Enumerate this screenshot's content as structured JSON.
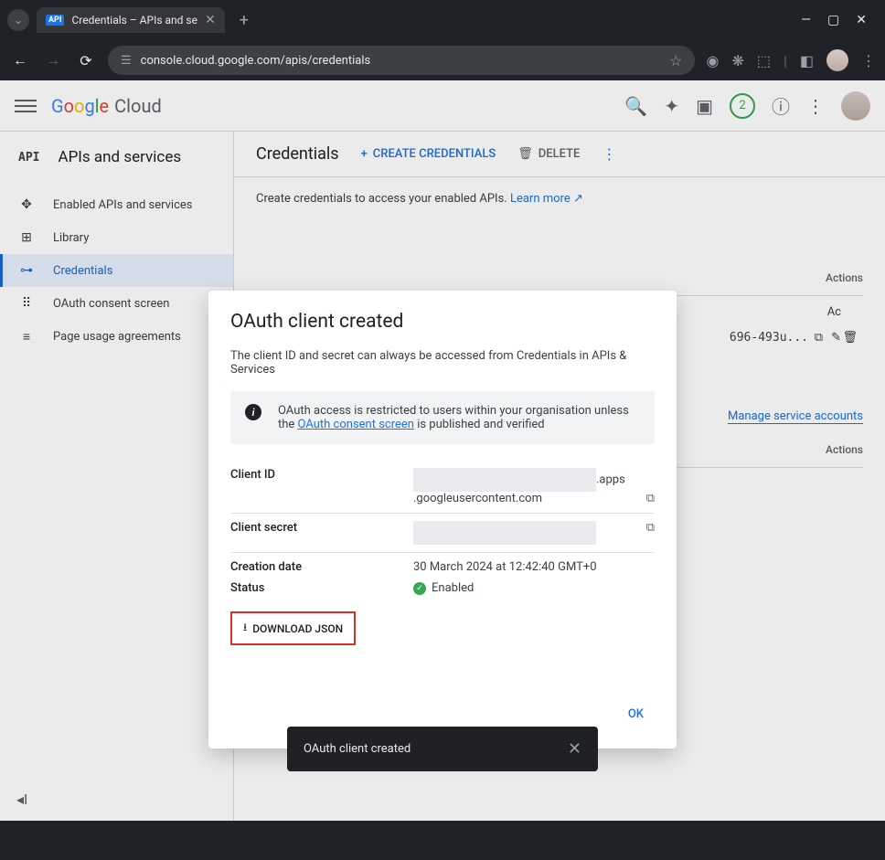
{
  "browser": {
    "tab_title": "Credentials – APIs and se",
    "url": "console.cloud.google.com/apis/credentials"
  },
  "header": {
    "logo_cloud": "Cloud",
    "notification_count": "2"
  },
  "sidebar": {
    "api_label": "API",
    "title": "APIs and services",
    "items": [
      {
        "label": "Enabled APIs and services"
      },
      {
        "label": "Library"
      },
      {
        "label": "Credentials"
      },
      {
        "label": "OAuth consent screen"
      },
      {
        "label": "Page usage agreements"
      }
    ]
  },
  "main": {
    "title": "Credentials",
    "create_label": "CREATE CREDENTIALS",
    "delete_label": "DELETE",
    "intro": "Create credentials to access your enabled APIs.",
    "learn_more": "Learn more",
    "actions_col": "Actions",
    "actions_col2": "Ac",
    "client_id_frag": "696-493u...",
    "manage_link": "Manage service accounts"
  },
  "dialog": {
    "title": "OAuth client created",
    "desc": "The client ID and secret can always be accessed from Credentials in APIs & Services",
    "info_prefix": "OAuth access is restricted to users within your organisation unless the ",
    "info_link": "OAuth consent screen",
    "info_suffix": " is published and verified",
    "client_id_label": "Client ID",
    "client_id_suffix": ".apps",
    "client_id_suffix2": ".googleusercontent.com",
    "client_secret_label": "Client secret",
    "creation_label": "Creation date",
    "creation_value": "30 March 2024 at 12:42:40 GMT+0",
    "status_label": "Status",
    "status_value": "Enabled",
    "download_label": "DOWNLOAD JSON",
    "ok_label": "OK"
  },
  "toast": {
    "message": "OAuth client created"
  }
}
